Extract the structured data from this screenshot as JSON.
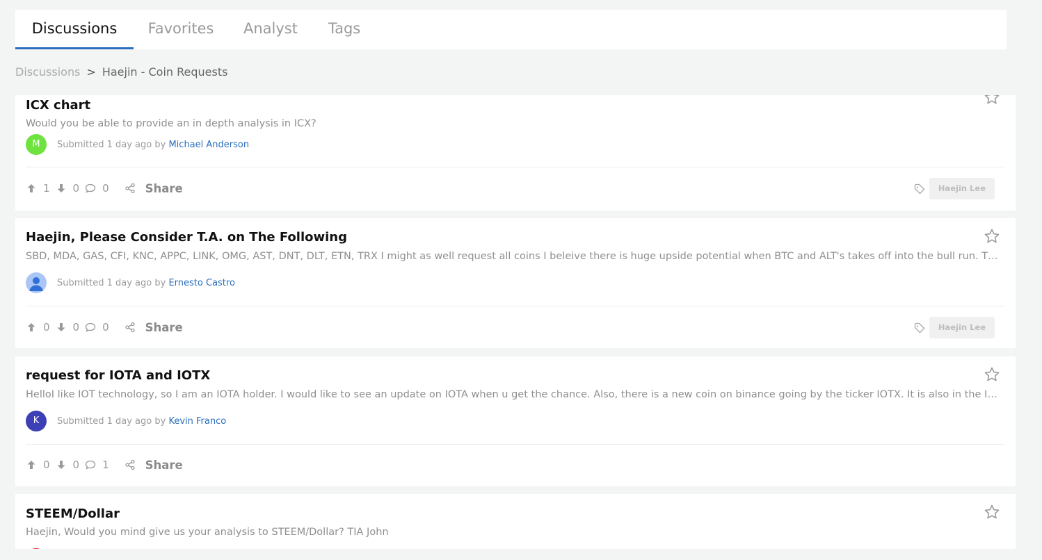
{
  "tabs": [
    {
      "label": "Discussions"
    },
    {
      "label": "Favorites"
    },
    {
      "label": "Analyst"
    },
    {
      "label": "Tags"
    }
  ],
  "breadcrumb": {
    "root": "Discussions",
    "separator": ">",
    "current": "Haejin - Coin Requests"
  },
  "posts": [
    {
      "title": "ICX chart",
      "description": "Would you be able to provide an in depth analysis in ICX?",
      "avatar_letter": "M",
      "avatar_color": "#6ee33f",
      "submitted_prefix": "Submitted",
      "time": "1 day ago",
      "by": "by",
      "author": "Michael Anderson",
      "upvotes": "1",
      "downvotes": "0",
      "comments": "0",
      "share_label": "Share",
      "tag": "Haejin Lee"
    },
    {
      "title": "Haejin, Please Consider T.A. on The Following",
      "description": "SBD, MDA, GAS, CFI, KNC, APPC, LINK, OMG, AST, DNT, DLT, ETN, TRX I might as well request all coins I beleive there is huge upside potential when BTC and ALT's takes off into the bull run. Thanks!",
      "avatar_letter": "",
      "avatar_color": "#8fb8f5",
      "submitted_prefix": "Submitted",
      "time": "1 day ago",
      "by": "by",
      "author": "Ernesto Castro",
      "upvotes": "0",
      "downvotes": "0",
      "comments": "0",
      "share_label": "Share",
      "tag": "Haejin Lee"
    },
    {
      "title": "request for IOTA and IOTX",
      "description": "HelloI like IOT technology, so I am an IOTA holder. I would like to see an update on IOTA when u get the chance. Also, there is a new coin on binance going by the ticker IOTX. It is also in the IOT space.",
      "avatar_letter": "K",
      "avatar_color": "#3d3fb5",
      "submitted_prefix": "Submitted",
      "time": "1 day ago",
      "by": "by",
      "author": "Kevin Franco",
      "upvotes": "0",
      "downvotes": "0",
      "comments": "1",
      "share_label": "Share",
      "tag": ""
    },
    {
      "title": "STEEM/Dollar",
      "description": "Haejin, Would you mind give us your analysis to STEEM/Dollar?  TIA John"
    }
  ],
  "colors": {
    "accent": "#2a6ebd",
    "muted": "#9a9a9a"
  }
}
